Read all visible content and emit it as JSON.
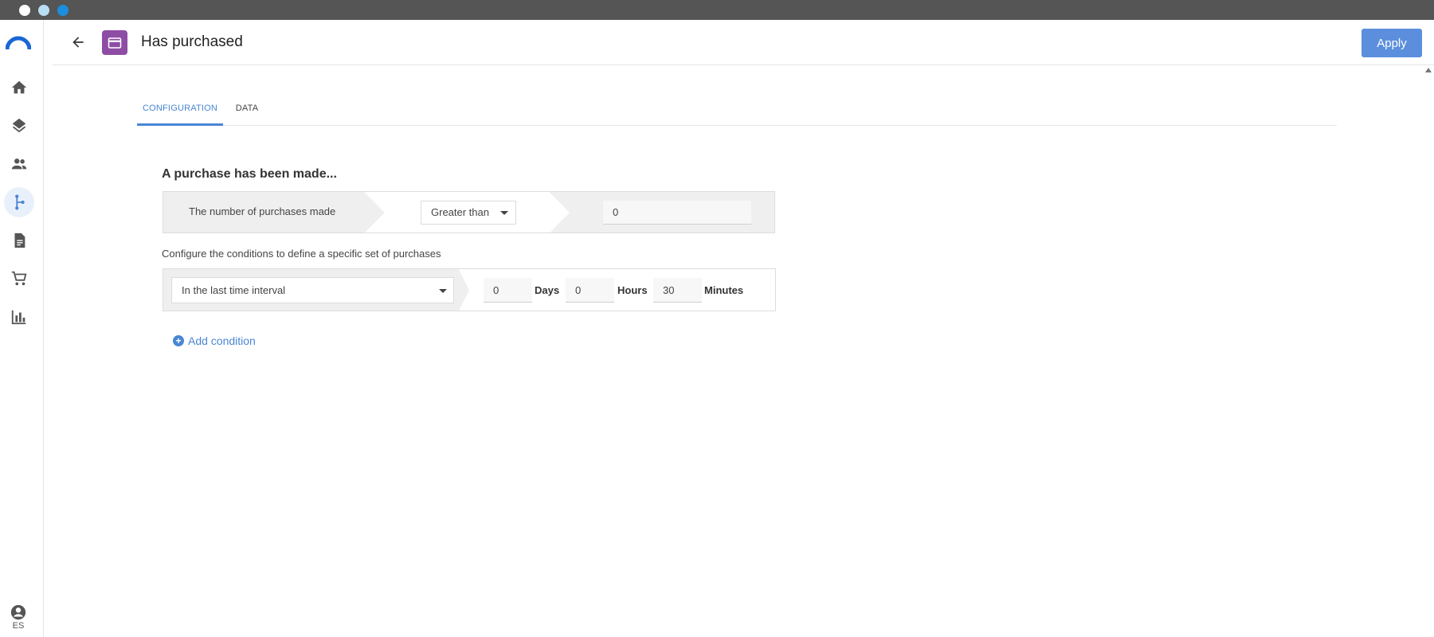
{
  "window": {
    "controls": [
      "close",
      "minimize",
      "maximize"
    ]
  },
  "rail": {
    "items": [
      {
        "name": "home",
        "icon": "home-icon",
        "active": false
      },
      {
        "name": "layers",
        "icon": "layers-icon",
        "active": false
      },
      {
        "name": "people",
        "icon": "people-icon",
        "active": false
      },
      {
        "name": "flows",
        "icon": "flow-icon",
        "active": true
      },
      {
        "name": "documents",
        "icon": "document-icon",
        "active": false
      },
      {
        "name": "cart",
        "icon": "cart-icon",
        "active": false
      },
      {
        "name": "analytics",
        "icon": "bar-chart-icon",
        "active": false
      }
    ],
    "user_lang": "ES"
  },
  "header": {
    "title": "Has purchased",
    "apply_label": "Apply",
    "entity_color": "#8e4da5",
    "accent_color": "#5b8fdd"
  },
  "tabs": [
    {
      "label": "CONFIGURATION",
      "active": true
    },
    {
      "label": "DATA",
      "active": false
    }
  ],
  "section": {
    "title": "A purchase has been made...",
    "condition": {
      "label": "The number of purchases made",
      "comparator": "Greater than",
      "value": "0"
    },
    "helper_text": "Configure the conditions to define a specific set of purchases",
    "time_condition": {
      "interval": "In the last time interval",
      "days": "0",
      "days_label": "Days",
      "hours": "0",
      "hours_label": "Hours",
      "minutes": "30",
      "minutes_label": "Minutes"
    },
    "add_condition_label": "Add condition"
  }
}
